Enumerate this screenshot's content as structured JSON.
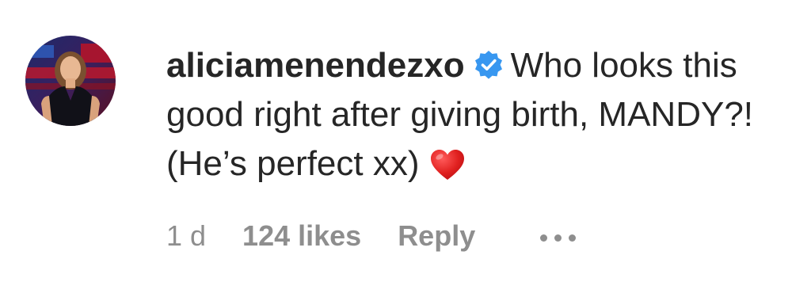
{
  "comment": {
    "username": "aliciamenendezxo",
    "verified": true,
    "text": "Who looks this good right after giving birth, MANDY?! (He’s perfect xx)",
    "emoji": "red-heart",
    "timestamp": "1 d",
    "likes": "124 likes",
    "reply_label": "Reply"
  },
  "colors": {
    "text": "#262626",
    "muted": "#8e8e8e",
    "verified_badge": "#3897f0",
    "heart": "#e0201f"
  },
  "icons": {
    "verified": "verified-badge-icon",
    "heart": "red-heart-icon",
    "more": "more-options-icon"
  }
}
